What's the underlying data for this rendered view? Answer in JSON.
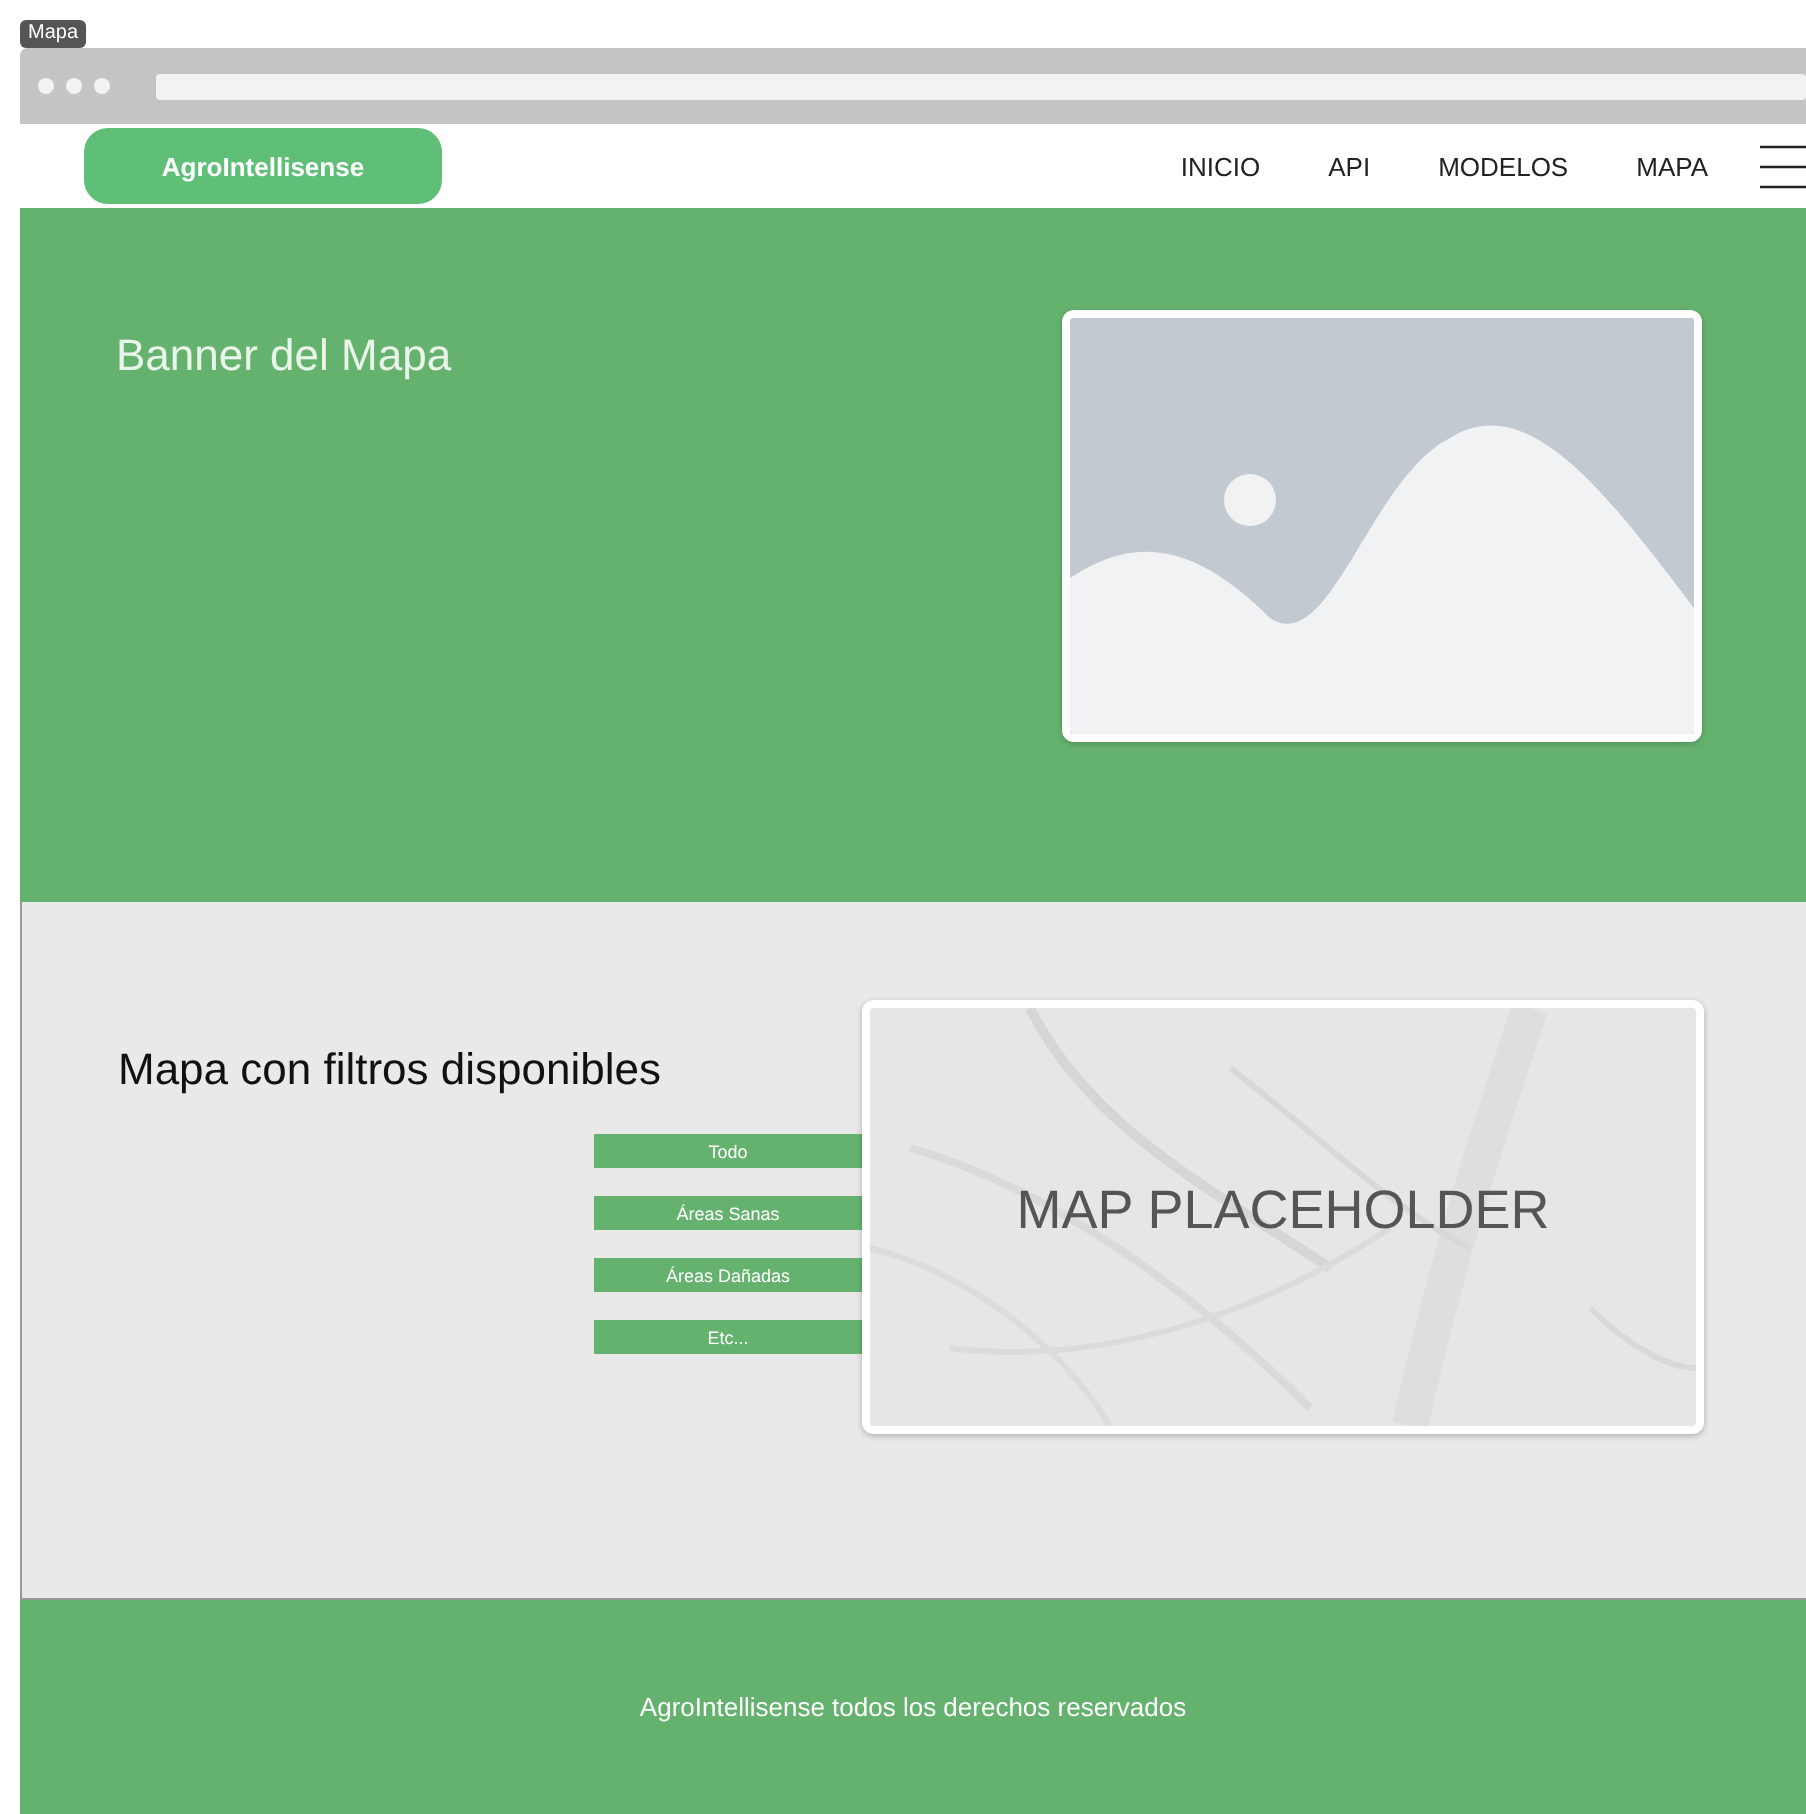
{
  "frame_label": "Mapa",
  "navbar": {
    "logo": "AgroIntellisense",
    "links": [
      {
        "label": "INICIO"
      },
      {
        "label": "API"
      },
      {
        "label": "MODELOS"
      },
      {
        "label": "MAPA"
      }
    ]
  },
  "banner": {
    "title": "Banner del Mapa"
  },
  "map_section": {
    "title": "Mapa con filtros disponibles",
    "filters": [
      {
        "label": "Todo"
      },
      {
        "label": "Áreas Sanas"
      },
      {
        "label": "Áreas Dañadas"
      },
      {
        "label": "Etc..."
      }
    ],
    "map": {
      "kind": "picture",
      "overlay_text": "MAP PLACEHOLDER"
    }
  },
  "footer": {
    "text": "AgroIntellisense todos los derechos reservados"
  }
}
